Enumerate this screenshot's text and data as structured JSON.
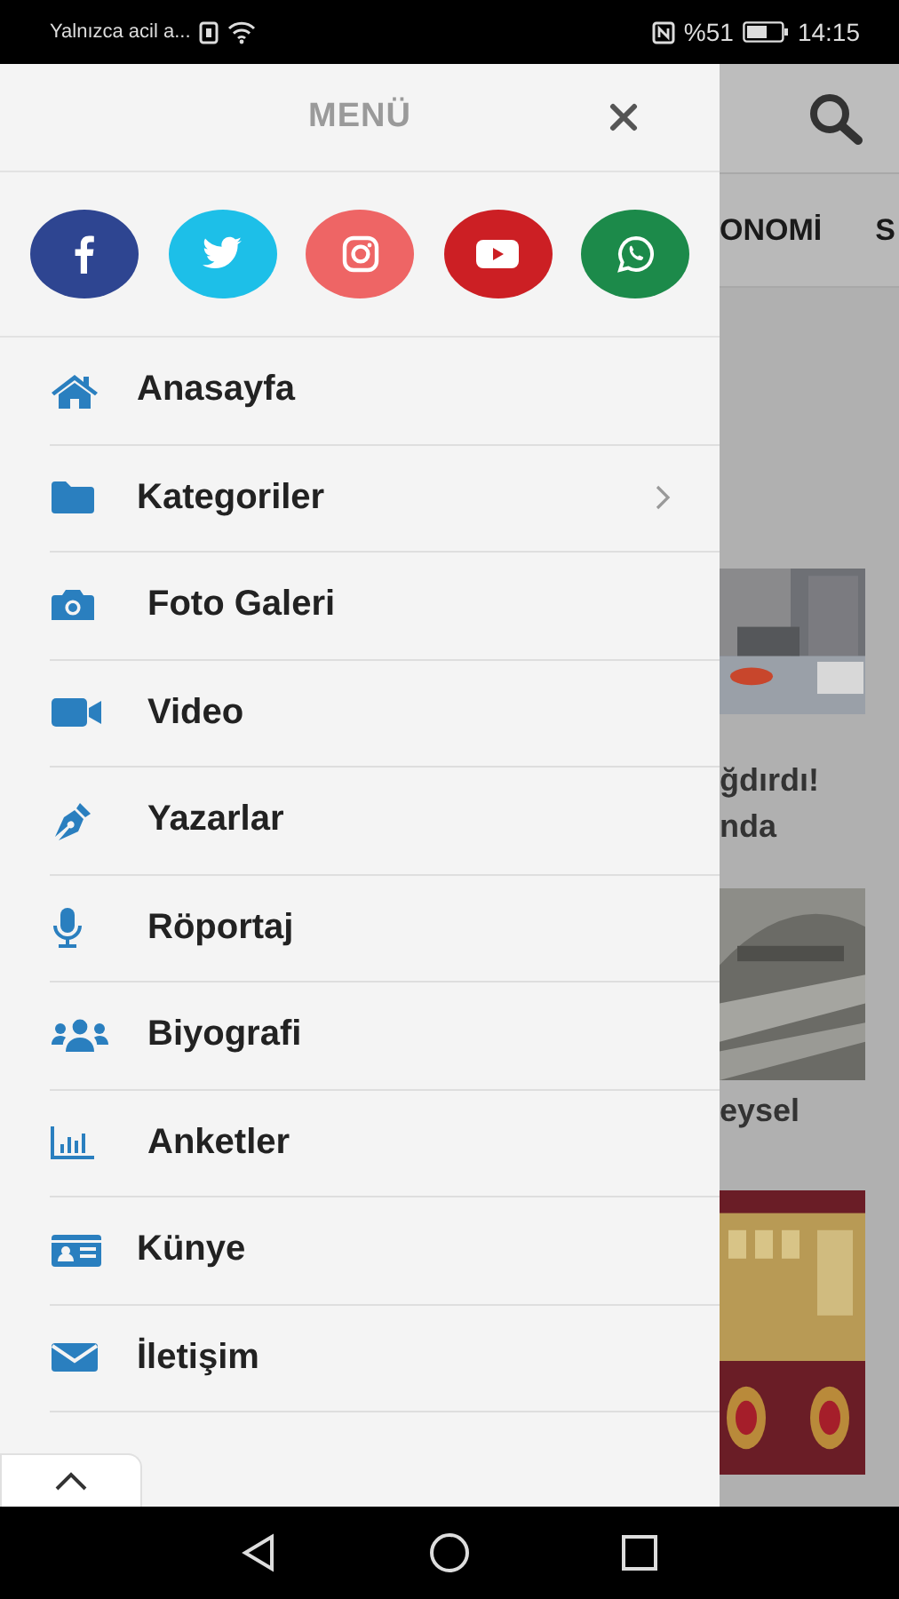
{
  "status_bar": {
    "notice": "Yalnızca acil a...",
    "battery": "%51",
    "time": "14:15"
  },
  "menu": {
    "title": "MENÜ",
    "social": [
      {
        "color": "#2e4591"
      },
      {
        "color": "#1dbfe8"
      },
      {
        "color": "#ee6565"
      },
      {
        "color": "#cc1f24"
      },
      {
        "color": "#1c8a4a"
      }
    ],
    "items": [
      {
        "label": "Anasayfa",
        "has_submenu": false
      },
      {
        "label": "Kategoriler",
        "has_submenu": true
      },
      {
        "label": "Foto Galeri",
        "has_submenu": false
      },
      {
        "label": "Video",
        "has_submenu": false
      },
      {
        "label": "Yazarlar",
        "has_submenu": false
      },
      {
        "label": "Röportaj",
        "has_submenu": false
      },
      {
        "label": "Biyografi",
        "has_submenu": false
      },
      {
        "label": "Anketler",
        "has_submenu": false
      },
      {
        "label": "Künye",
        "has_submenu": false
      },
      {
        "label": "İletişim",
        "has_submenu": false
      }
    ]
  },
  "background_page": {
    "categories": [
      "ONOMİ",
      "S"
    ],
    "articles": [
      {
        "title_lines": [
          "ğdırdı!",
          "nda"
        ]
      },
      {
        "title_lines": [
          "eysel"
        ]
      }
    ]
  }
}
